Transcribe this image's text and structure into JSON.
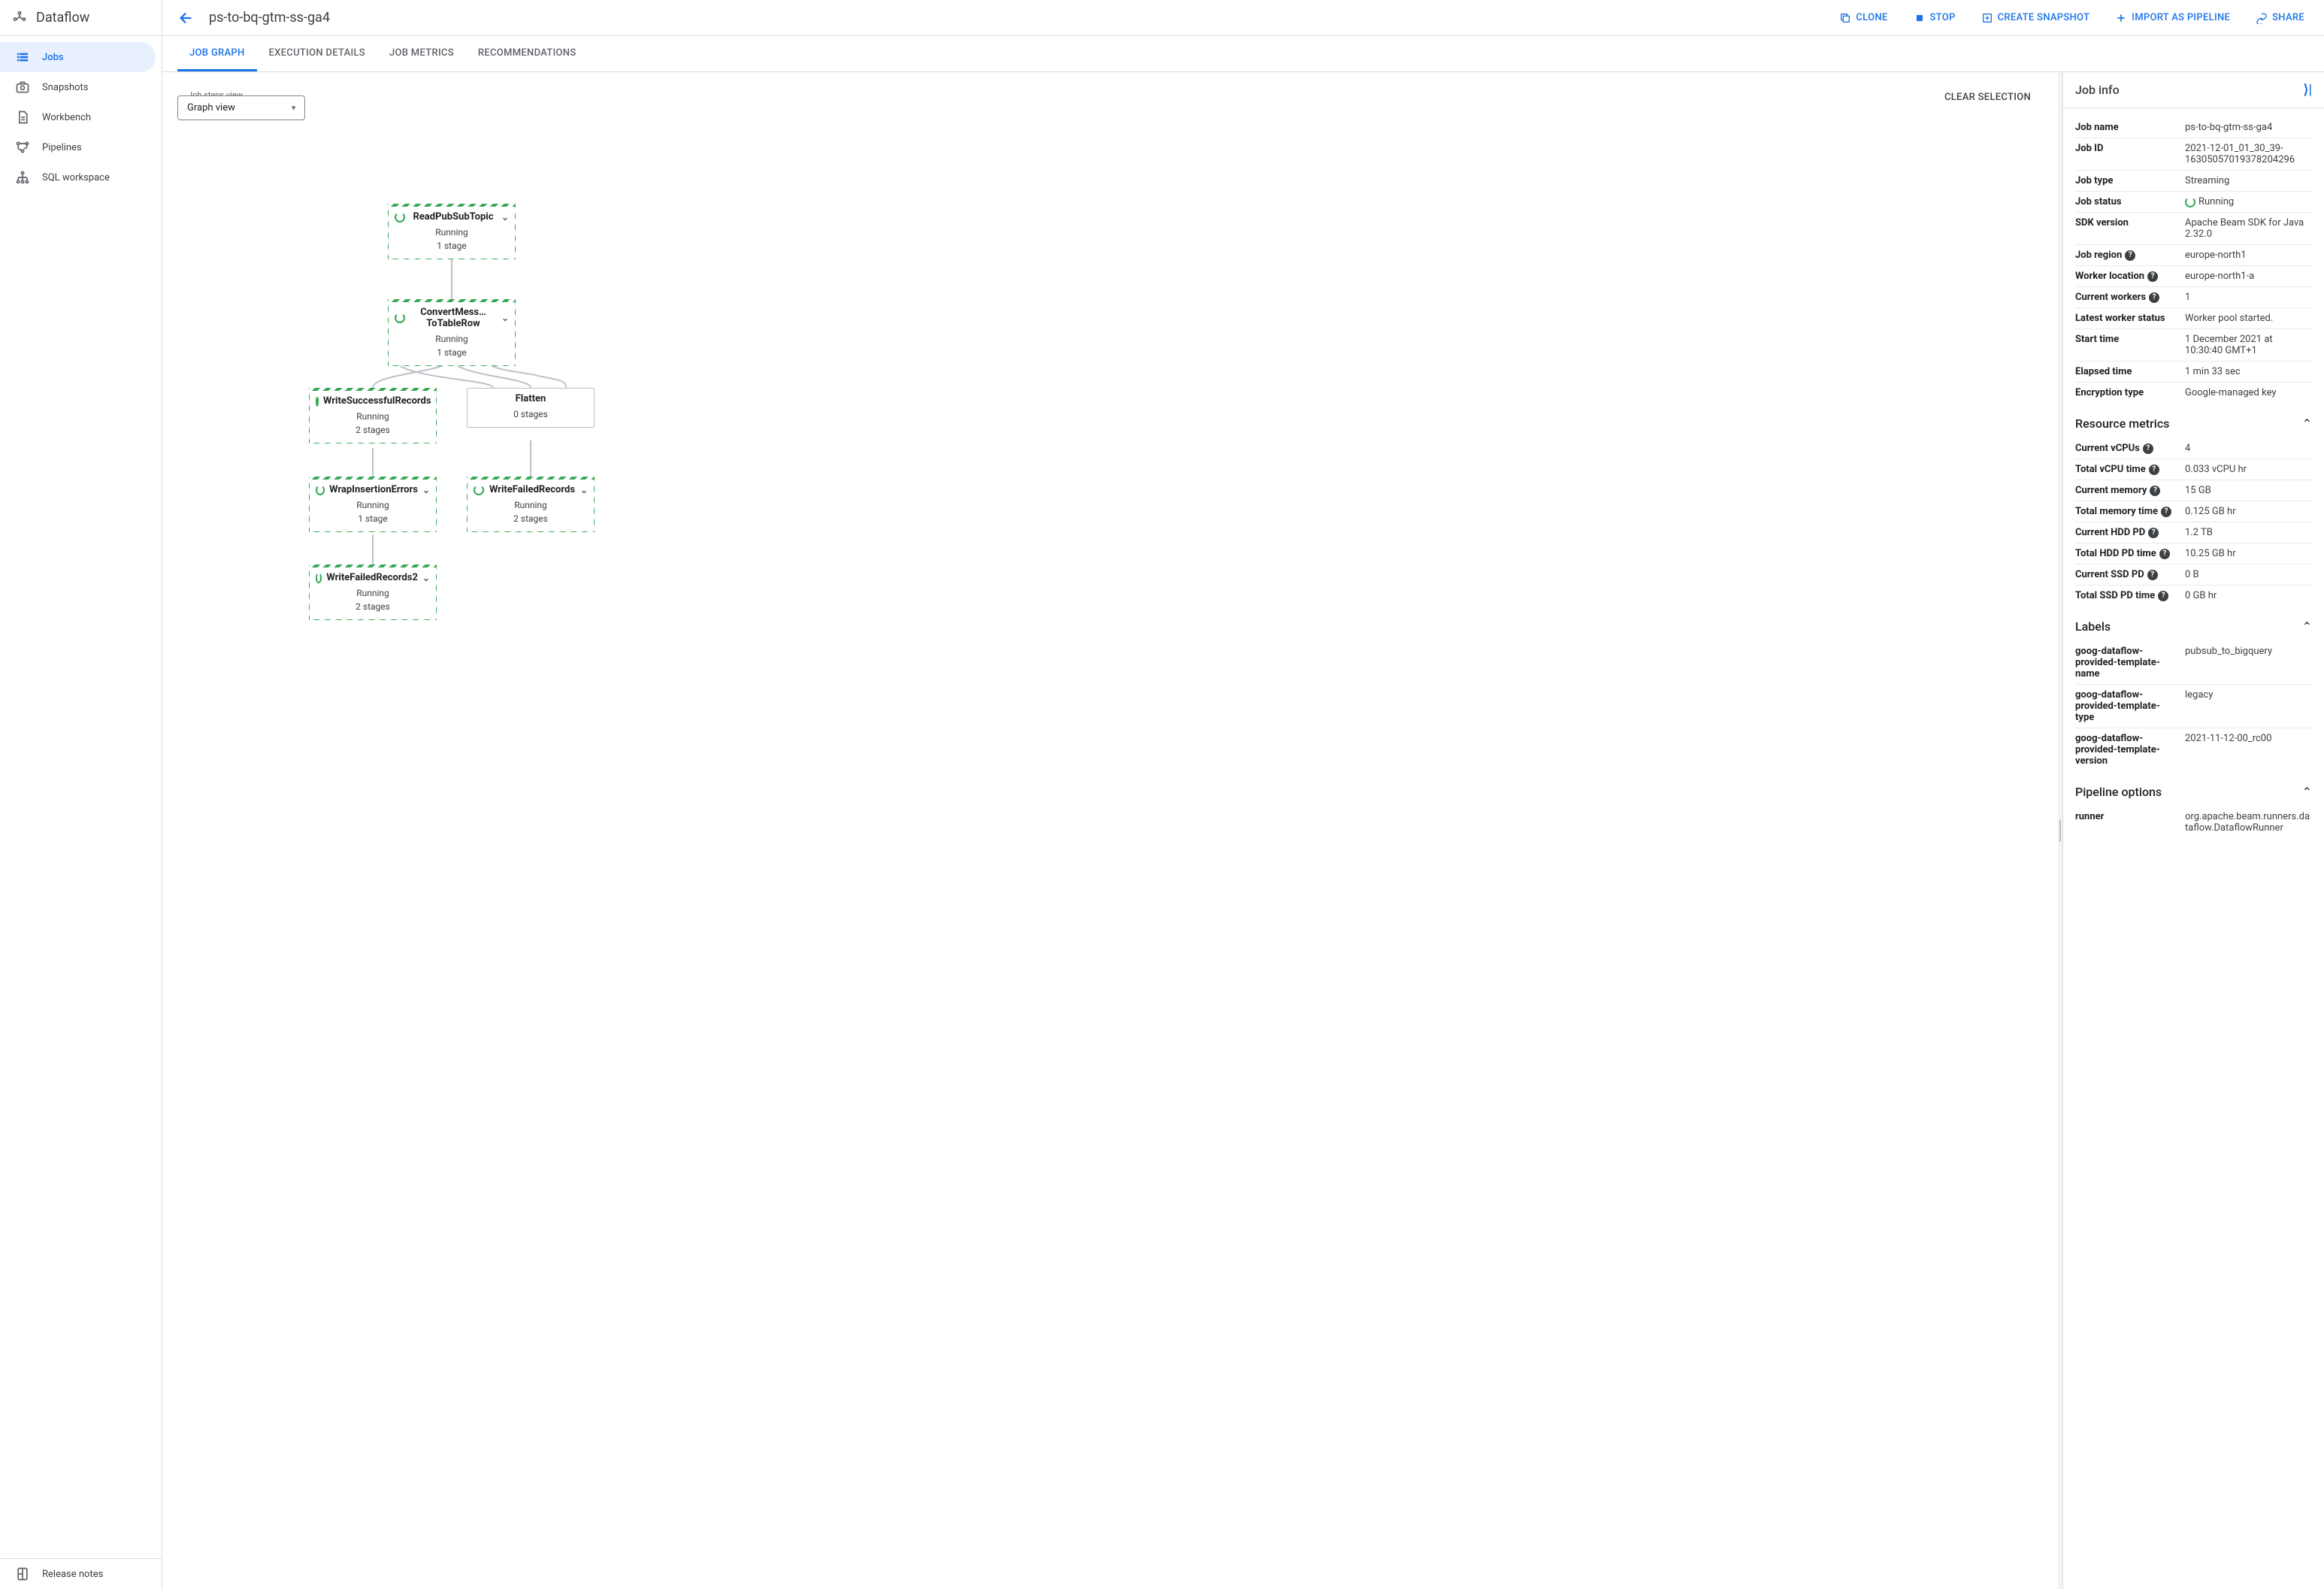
{
  "product": "Dataflow",
  "sidebar": {
    "items": [
      {
        "label": "Jobs",
        "active": true
      },
      {
        "label": "Snapshots"
      },
      {
        "label": "Workbench"
      },
      {
        "label": "Pipelines"
      },
      {
        "label": "SQL workspace"
      }
    ],
    "footer": "Release notes"
  },
  "header": {
    "job_name": "ps-to-bq-gtm-ss-ga4",
    "actions": {
      "clone": "Clone",
      "stop": "Stop",
      "snapshot": "Create snapshot",
      "import": "Import as pipeline",
      "share": "Share"
    }
  },
  "tabs": [
    "Job Graph",
    "Execution Details",
    "Job Metrics",
    "Recommendations"
  ],
  "graph_controls": {
    "field_label": "Job steps view",
    "value": "Graph view",
    "clear": "CLEAR SELECTION"
  },
  "nodes": {
    "n1": {
      "title": "ReadPubSubTopic",
      "status": "Running",
      "detail": "1 stage",
      "running": true
    },
    "n2": {
      "title": "ConvertMess…ToTableRow",
      "status": "Running",
      "detail": "1 stage",
      "running": true
    },
    "n3": {
      "title": "WriteSuccessfulRecords",
      "status": "Running",
      "detail": "2 stages",
      "running": true
    },
    "n4": {
      "title": "Flatten",
      "status": "",
      "detail": "0 stages",
      "running": false
    },
    "n5": {
      "title": "WrapInsertionErrors",
      "status": "Running",
      "detail": "1 stage",
      "running": true
    },
    "n6": {
      "title": "WriteFailedRecords",
      "status": "Running",
      "detail": "2 stages",
      "running": true
    },
    "n7": {
      "title": "WriteFailedRecords2",
      "status": "Running",
      "detail": "2 stages",
      "running": true
    }
  },
  "info_panel_title": "Job info",
  "job_info": [
    {
      "label": "Job name",
      "value": "ps-to-bq-gtm-ss-ga4"
    },
    {
      "label": "Job ID",
      "value": "2021-12-01_01_30_39-16305057019378204296"
    },
    {
      "label": "Job type",
      "value": "Streaming"
    },
    {
      "label": "Job status",
      "value": "Running",
      "spinner": true
    },
    {
      "label": "SDK version",
      "value": "Apache Beam SDK for Java 2.32.0"
    },
    {
      "label": "Job region",
      "value": "europe-north1",
      "help": true
    },
    {
      "label": "Worker location",
      "value": "europe-north1-a",
      "help": true
    },
    {
      "label": "Current workers",
      "value": "1",
      "help": true
    },
    {
      "label": "Latest worker status",
      "value": "Worker pool started."
    },
    {
      "label": "Start time",
      "value": "1 December 2021 at 10:30:40 GMT+1"
    },
    {
      "label": "Elapsed time",
      "value": "1 min 33 sec"
    },
    {
      "label": "Encryption type",
      "value": "Google-managed key"
    }
  ],
  "resource_title": "Resource metrics",
  "resource_metrics": [
    {
      "label": "Current vCPUs",
      "value": "4",
      "help": true
    },
    {
      "label": "Total vCPU time",
      "value": "0.033 vCPU hr",
      "help": true
    },
    {
      "label": "Current memory",
      "value": "15 GB",
      "help": true
    },
    {
      "label": "Total memory time",
      "value": "0.125 GB hr",
      "help": true
    },
    {
      "label": "Current HDD PD",
      "value": "1.2 TB",
      "help": true
    },
    {
      "label": "Total HDD PD time",
      "value": "10.25 GB hr",
      "help": true
    },
    {
      "label": "Current SSD PD",
      "value": "0 B",
      "help": true
    },
    {
      "label": "Total SSD PD time",
      "value": "0 GB hr",
      "help": true
    }
  ],
  "labels_title": "Labels",
  "labels": [
    {
      "label": "goog-dataflow-provided-template-name",
      "value": "pubsub_to_bigquery"
    },
    {
      "label": "goog-dataflow-provided-template-type",
      "value": "legacy"
    },
    {
      "label": "goog-dataflow-provided-template-version",
      "value": "2021-11-12-00_rc00"
    }
  ],
  "pipeline_title": "Pipeline options",
  "pipeline_options": [
    {
      "label": "runner",
      "value": "org.apache.beam.runners.dataflow.DataflowRunner"
    }
  ]
}
